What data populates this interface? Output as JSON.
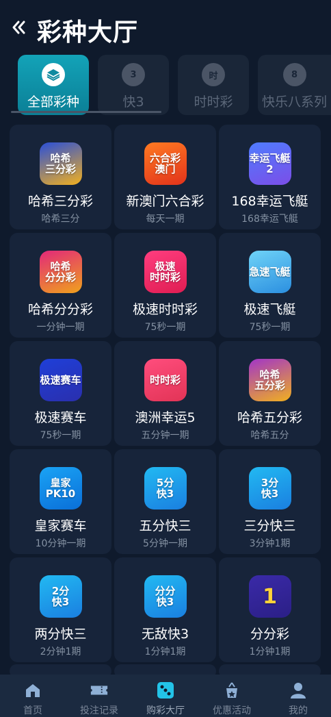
{
  "header": {
    "title": "彩种大厅",
    "back_icon": "chevron-left-icon"
  },
  "tabs": [
    {
      "label": "全部彩种",
      "icon": "layers-icon",
      "active": true
    },
    {
      "label": "快3",
      "icon": "k3-icon",
      "active": false
    },
    {
      "label": "时时彩",
      "icon": "ssc-icon",
      "active": false
    },
    {
      "label": "快乐八系列",
      "icon": "kl8-icon",
      "active": false
    }
  ],
  "games": [
    {
      "name": "哈希三分彩",
      "sub": "哈希三分",
      "icon_text": "哈希\n三分彩",
      "colors": [
        "#2a4fd8",
        "#f2b01f"
      ]
    },
    {
      "name": "新澳门六合彩",
      "sub": "每天一期",
      "icon_text": "六合彩\n澳门",
      "colors": [
        "#ff7a22",
        "#e2331b"
      ]
    },
    {
      "name": "168幸运飞艇",
      "sub": "168幸运飞艇",
      "icon_text": "幸运飞艇2",
      "colors": [
        "#4f7cff",
        "#7b4ee8"
      ]
    },
    {
      "name": "哈希分分彩",
      "sub": "一分钟一期",
      "icon_text": "哈希\n分分彩",
      "colors": [
        "#e2287a",
        "#f0a21c"
      ]
    },
    {
      "name": "极速时时彩",
      "sub": "75秒一期",
      "icon_text": "极速\n时时彩",
      "colors": [
        "#ff3d7f",
        "#e01d52"
      ]
    },
    {
      "name": "极速飞艇",
      "sub": "75秒一期",
      "icon_text": "急速飞艇",
      "colors": [
        "#6fd3f7",
        "#2b8fe0"
      ]
    },
    {
      "name": "极速赛车",
      "sub": "75秒一期",
      "icon_text": "极速赛车",
      "colors": [
        "#1f3fd8",
        "#2a2fae"
      ]
    },
    {
      "name": "澳洲幸运5",
      "sub": "五分钟一期",
      "icon_text": "时时彩",
      "colors": [
        "#ff4d7d",
        "#e23456"
      ]
    },
    {
      "name": "哈希五分彩",
      "sub": "哈希五分",
      "icon_text": "哈希\n五分彩",
      "colors": [
        "#a235c8",
        "#f0b01f"
      ]
    },
    {
      "name": "皇家赛车",
      "sub": "10分钟一期",
      "icon_text": "皇家\nPK10",
      "colors": [
        "#1aa3f5",
        "#0a6fd8"
      ]
    },
    {
      "name": "五分快三",
      "sub": "5分钟一期",
      "icon_text": "5分\n快3",
      "colors": [
        "#22b9f2",
        "#1a7fe0"
      ]
    },
    {
      "name": "三分快三",
      "sub": "3分钟1期",
      "icon_text": "3分\n快3",
      "colors": [
        "#22b9f2",
        "#1a7fe0"
      ]
    },
    {
      "name": "两分快三",
      "sub": "2分钟1期",
      "icon_text": "2分\n快3",
      "colors": [
        "#22b9f2",
        "#1a7fe0"
      ]
    },
    {
      "name": "无敌快3",
      "sub": "1分钟1期",
      "icon_text": "分分\n快3",
      "colors": [
        "#22b9f2",
        "#1a7fe0"
      ]
    },
    {
      "name": "分分彩",
      "sub": "1分钟1期",
      "icon_text": "1",
      "colors": [
        "#3a2aa8",
        "#2b1f86"
      ]
    }
  ],
  "bottom_nav": [
    {
      "label": "首页",
      "icon": "home-icon",
      "active": false
    },
    {
      "label": "投注记录",
      "icon": "ticket-icon",
      "active": false
    },
    {
      "label": "购彩大厅",
      "icon": "dice-icon",
      "active": true
    },
    {
      "label": "优惠活动",
      "icon": "gift-icon",
      "active": false
    },
    {
      "label": "我的",
      "icon": "user-icon",
      "active": false
    }
  ]
}
